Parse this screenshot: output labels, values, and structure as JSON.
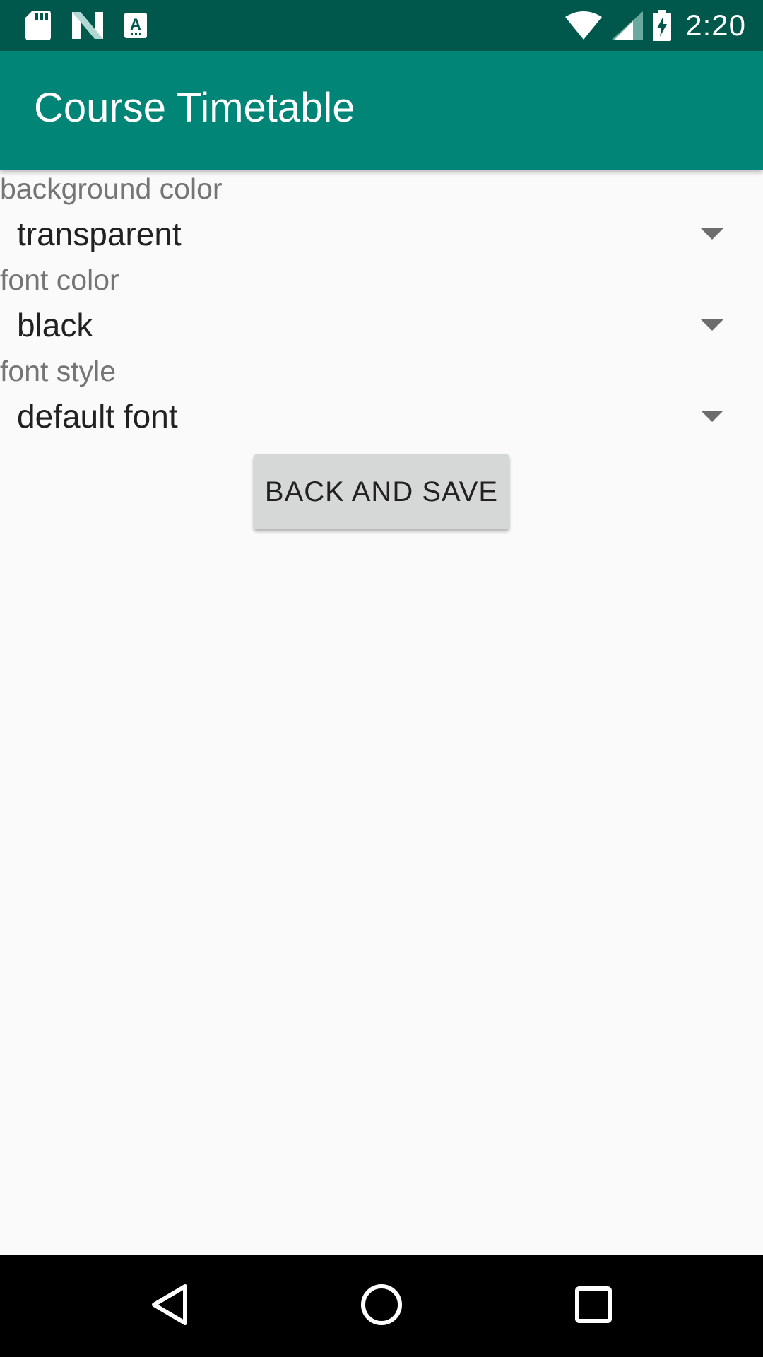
{
  "status_bar": {
    "time": "2:20",
    "left_icons": [
      "sd-card-icon",
      "n-logo-icon",
      "text-a-icon"
    ],
    "right_icons": [
      "wifi-icon",
      "cell-signal-icon",
      "battery-charging-icon"
    ]
  },
  "app_bar": {
    "title": "Course Timetable",
    "color": "#008577",
    "status_color": "#00574b"
  },
  "settings": [
    {
      "label": "background color",
      "value": "transparent"
    },
    {
      "label": "font color",
      "value": "black"
    },
    {
      "label": "font style",
      "value": "default font"
    }
  ],
  "actions": {
    "back_and_save_label": "BACK AND SAVE"
  },
  "nav_bar": {
    "buttons": [
      "back-icon",
      "home-icon",
      "recents-icon"
    ]
  }
}
